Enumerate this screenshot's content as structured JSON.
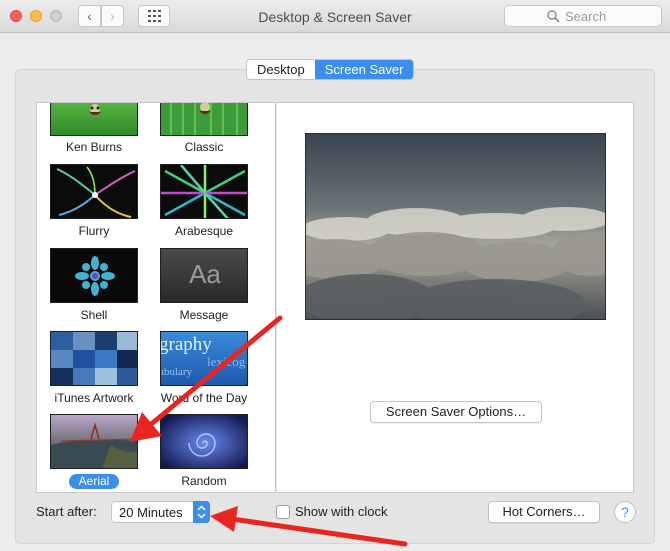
{
  "window": {
    "title": "Desktop & Screen Saver",
    "search_placeholder": "Search",
    "back_glyph": "‹",
    "forward_glyph": "›"
  },
  "tabs": [
    {
      "label": "Desktop",
      "active": false
    },
    {
      "label": "Screen Saver",
      "active": true
    }
  ],
  "savers": [
    {
      "label": "Ken Burns",
      "icon": "ken-burns-thumbnail"
    },
    {
      "label": "Classic",
      "icon": "classic-thumbnail"
    },
    {
      "label": "Flurry",
      "icon": "flurry-thumbnail"
    },
    {
      "label": "Arabesque",
      "icon": "arabesque-thumbnail"
    },
    {
      "label": "Shell",
      "icon": "shell-thumbnail"
    },
    {
      "label": "Message",
      "icon": "message-thumbnail",
      "thumb_text": "Aa"
    },
    {
      "label": "iTunes Artwork",
      "icon": "itunes-artwork-thumbnail"
    },
    {
      "label": "Word of the Day",
      "icon": "word-of-the-day-thumbnail",
      "thumb_words": [
        "graphy",
        "lexicog",
        "abulary"
      ]
    },
    {
      "label": "Aerial",
      "icon": "aerial-thumbnail",
      "selected": true
    },
    {
      "label": "Random",
      "icon": "random-thumbnail"
    }
  ],
  "preview": {
    "options_button": "Screen Saver Options…"
  },
  "bottom": {
    "start_after_label": "Start after:",
    "start_after_value": "20 Minutes",
    "show_clock_label": "Show with clock",
    "show_clock_checked": false,
    "hot_corners_button": "Hot Corners…",
    "help_button": "?"
  },
  "colors": {
    "accent": "#3b8ef0",
    "annotation_arrow": "#e8261f"
  }
}
